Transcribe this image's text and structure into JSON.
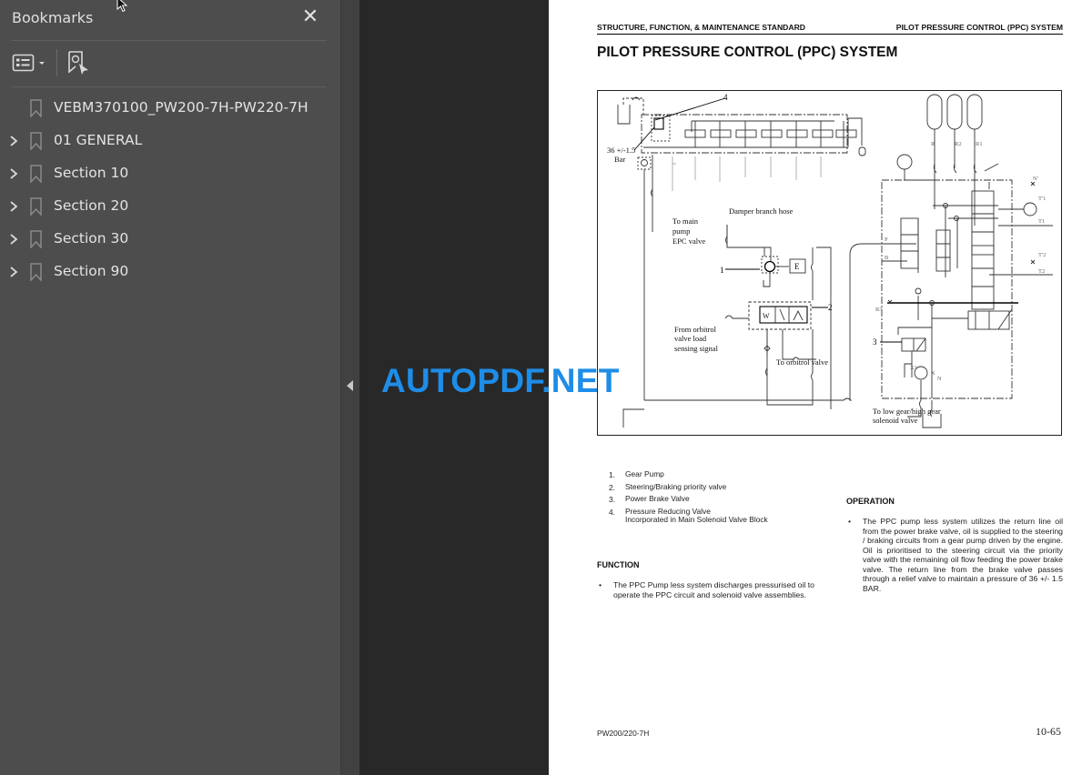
{
  "sidebar": {
    "title": "Bookmarks",
    "close_label": "✕",
    "toolbar": {
      "options_icon": "list-options-icon",
      "find_bookmark_icon": "find-current-bookmark-icon"
    },
    "items": [
      {
        "label": "VEBM370100_PW200-7H-PW220-7H",
        "expandable": false
      },
      {
        "label": "01 GENERAL",
        "expandable": true
      },
      {
        "label": "Section 10",
        "expandable": true
      },
      {
        "label": "Section 20",
        "expandable": true
      },
      {
        "label": "Section 30",
        "expandable": true
      },
      {
        "label": "Section 90",
        "expandable": true
      }
    ]
  },
  "page": {
    "running_head_left": "STRUCTURE, FUNCTION, & MAINTENANCE STANDARD",
    "running_head_right": "PILOT PRESSURE CONTROL (PPC) SYSTEM",
    "title": "PILOT PRESSURE CONTROL (PPC) SYSTEM",
    "diagram": {
      "callouts": [
        "1",
        "2",
        "3",
        "4"
      ],
      "labels": {
        "pressure": "36 +/-1.5",
        "pressure_unit": "Bar",
        "to_main_pump_1": "To main",
        "to_main_pump_2": "pump",
        "to_main_pump_3": "EPC valve",
        "damper": "Damper branch hose",
        "from_orbitrol_1": "From orbitrol",
        "from_orbitrol_2": "valve load",
        "from_orbitrol_3": "sensing signal",
        "to_orbitrol": "To orbitrol valve",
        "to_low_gear_1": "To low gear/high gear",
        "to_low_gear_2": "solenoid valve",
        "port_r": "R",
        "port_r2": "R2",
        "port_r1": "R1",
        "port_p": "P",
        "port_b": "B",
        "port_r3": "R3",
        "port_n_top": "N'",
        "port_t1p": "T'1",
        "port_t1": "T1",
        "port_t2p": "T'2",
        "port_t2": "T2",
        "port_x1": "X1",
        "port_x": "X",
        "port_n": "N",
        "box_e": "E",
        "box_w": "W"
      }
    },
    "legend": [
      {
        "num": "1.",
        "text": "Gear Pump"
      },
      {
        "num": "2.",
        "text": "Steering/Braking priority valve"
      },
      {
        "num": "3.",
        "text": "Power Brake Valve"
      },
      {
        "num": "4.",
        "text": "Pressure Reducing Valve",
        "text2": "Incorporated in Main Solenoid Valve Block"
      }
    ],
    "function": {
      "heading": "FUNCTION",
      "bullet": "•",
      "text": "The PPC Pump less system discharges pressurised oil to operate the PPC circuit and solenoid valve assemblies."
    },
    "operation": {
      "heading": "OPERATION",
      "bullet": "•",
      "text": "The PPC pump less system utilizes the return line oil from the power brake valve, oil is supplied to the steering / braking circuits from a gear pump driven by the engine. Oil is prioritised to the steering circuit via the priority valve with the remaining oil flow feeding the power brake valve. The return line from the brake valve passes through a relief valve to maintain a pressure of 36 +/- 1.5 BAR."
    },
    "footer_left": "PW200/220-7H",
    "footer_right": "10-65"
  },
  "watermark": "AUTOPDF.NET",
  "colors": {
    "sidebar_bg": "#4d4d4d",
    "viewer_bg": "#282828",
    "watermark": "#1e8de8"
  }
}
